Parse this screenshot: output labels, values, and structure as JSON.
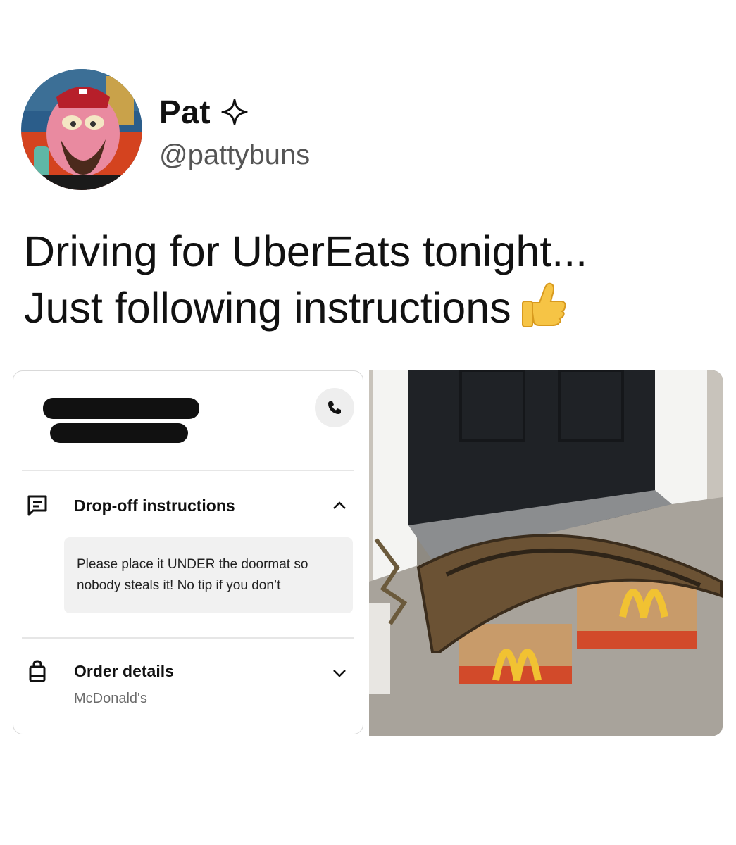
{
  "tweet": {
    "display_name": "Pat",
    "verified_icon": "sparkle-badge-icon",
    "handle": "@pattybuns",
    "text_line1": "Driving for UberEats tonight...",
    "text_line2": "Just following instructions",
    "emoji": "thumbs-up-emoji"
  },
  "delivery_card": {
    "call_icon": "phone-icon",
    "dropoff": {
      "icon": "message-icon",
      "title": "Drop-off instructions",
      "chevron": "chevron-up-icon",
      "note_line1": "Please place it UNDER the doormat so",
      "note_line2": "nobody steals it! No tip if you don’t"
    },
    "order": {
      "icon": "shopping-bag-icon",
      "title": "Order details",
      "chevron": "chevron-down-icon",
      "restaurant": "McDonald's"
    }
  },
  "photo": {
    "subject": "doormat-over-delivery-bags"
  }
}
